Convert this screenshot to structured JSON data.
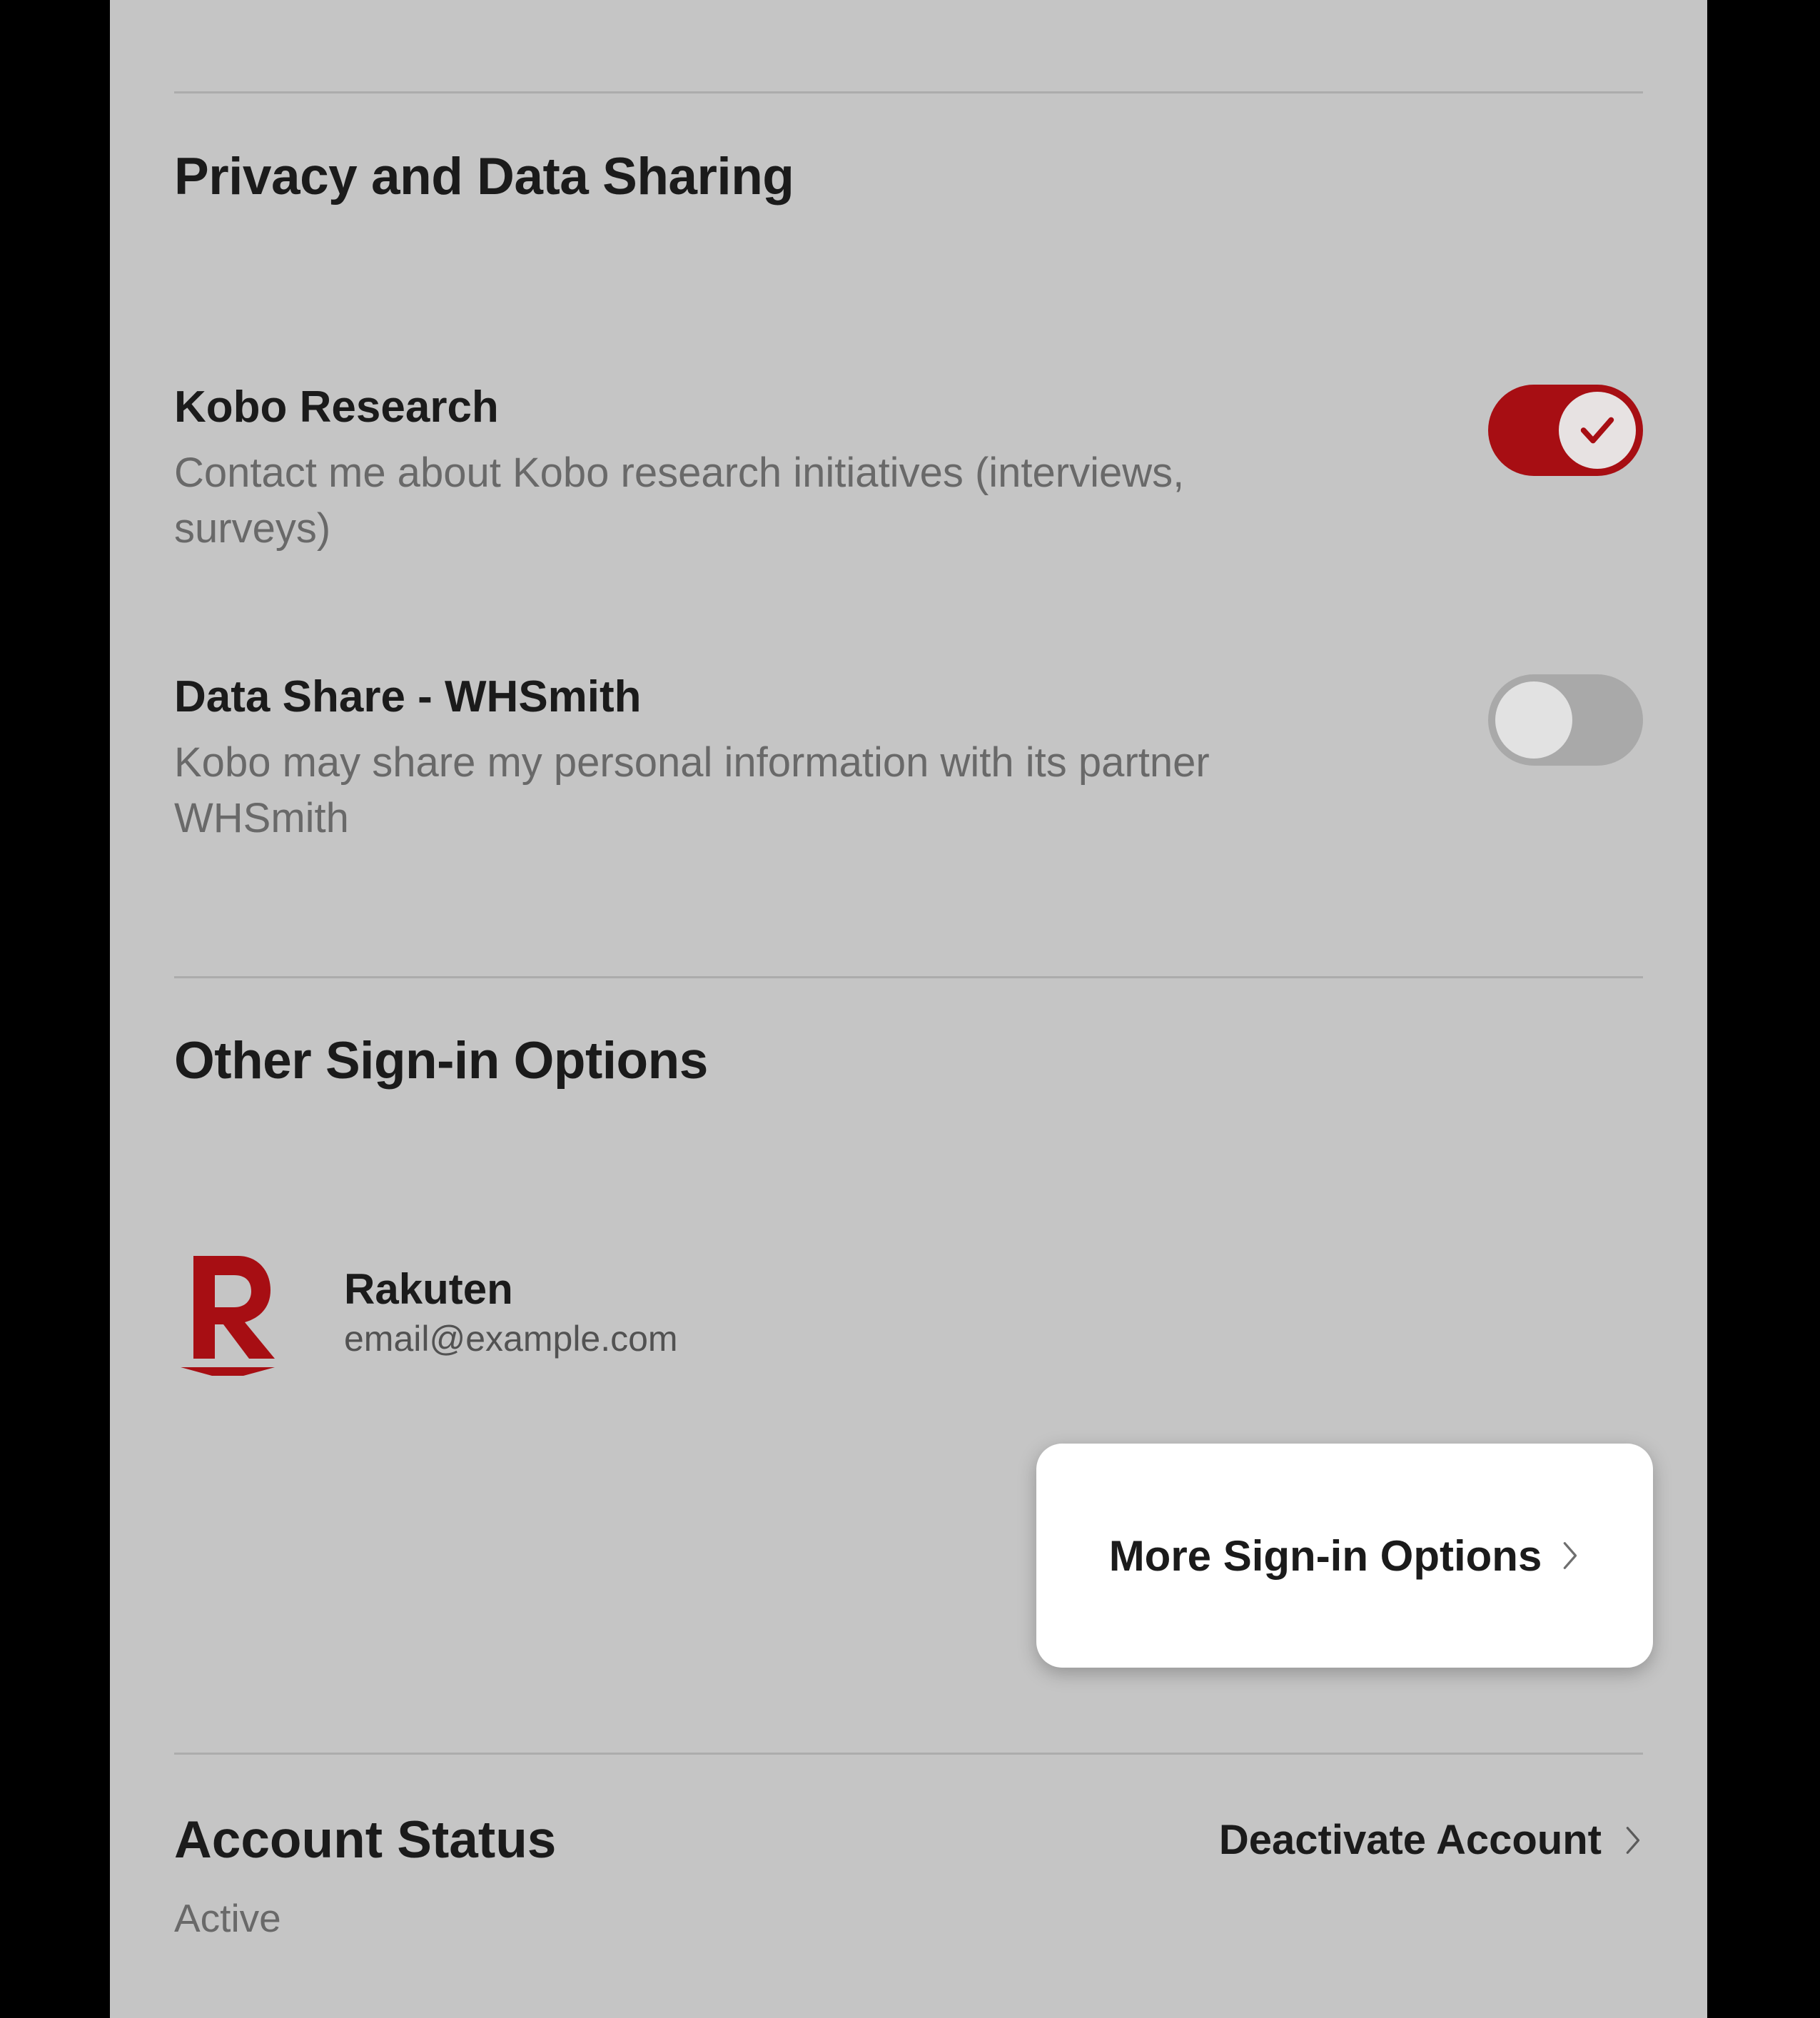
{
  "privacy": {
    "heading": "Privacy and Data Sharing",
    "items": [
      {
        "title": "Kobo Research",
        "desc": "Contact me about Kobo research initiatives (interviews, surveys)",
        "state": "on"
      },
      {
        "title": "Data Share - WHSmith",
        "desc": "Kobo may share my personal information with its partner WHSmith",
        "state": "off"
      }
    ]
  },
  "signin": {
    "heading": "Other Sign-in Options",
    "provider": {
      "name": "Rakuten",
      "email": "email@example.com"
    },
    "more_label": "More Sign-in Options"
  },
  "account": {
    "heading": "Account Status",
    "deactivate_label": "Deactivate Account",
    "status_value": "Active"
  },
  "colors": {
    "accent": "#a70e13"
  }
}
